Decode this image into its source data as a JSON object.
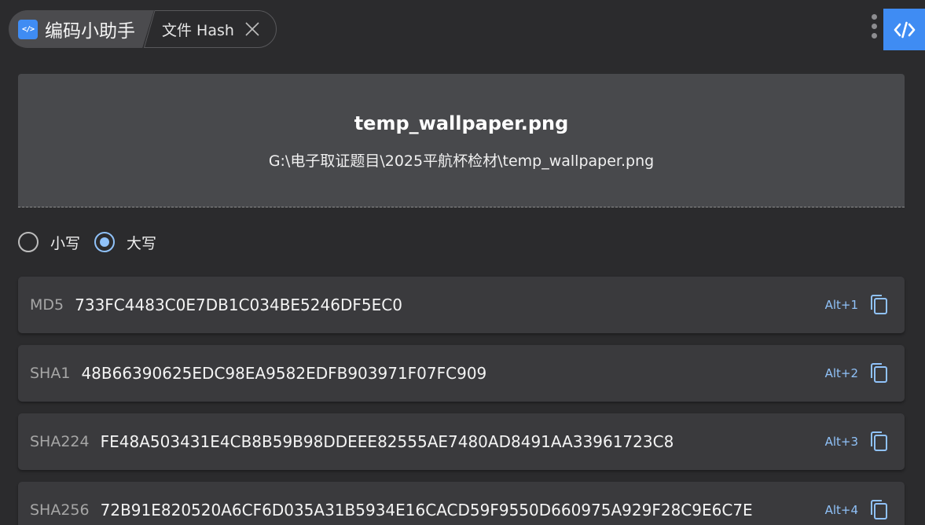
{
  "header": {
    "app_name": "编码小助手",
    "app_logo_text": "</>",
    "active_tab": "文件 Hash"
  },
  "file": {
    "name": "temp_wallpaper.png",
    "path": "G:\\电子取证题目\\2025平航杯检材\\temp_wallpaper.png"
  },
  "case_options": [
    {
      "label": "小写",
      "checked": false
    },
    {
      "label": "大写",
      "checked": true
    }
  ],
  "hashes": [
    {
      "algo": "MD5",
      "value": "733FC4483C0E7DB1C034BE5246DF5EC0",
      "shortcut": "Alt+1"
    },
    {
      "algo": "SHA1",
      "value": "48B66390625EDC98EA9582EDFB903971F07FC909",
      "shortcut": "Alt+2"
    },
    {
      "algo": "SHA224",
      "value": "FE48A503431E4CB8B59B98DDEEE82555AE7480AD8491AA33961723C8",
      "shortcut": "Alt+3"
    },
    {
      "algo": "SHA256",
      "value": "72B91E820520A6CF6D035A31B5934E16CACD59F9550D660975A929F28C9E6C7E",
      "shortcut": "Alt+4"
    }
  ],
  "icons": {
    "more": "more-vertical-icon",
    "code": "code-icon",
    "close": "close-icon",
    "copy": "copy-icon"
  },
  "colors": {
    "background": "#2b2b2d",
    "accent": "#3f8cf3",
    "radio_checked": "#90c2f9",
    "card": "#48494c",
    "row": "#3a3a3d"
  }
}
